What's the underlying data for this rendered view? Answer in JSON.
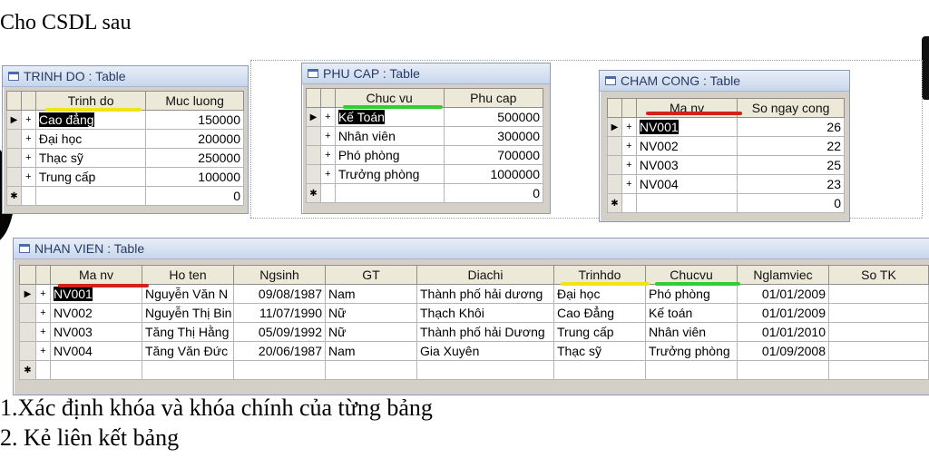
{
  "heading": "Cho CSDL sau",
  "questions": [
    "1.Xác định khóa và khóa chính của từng bảng",
    "2. Kẻ liên kết bảng"
  ],
  "colors": {
    "yellow_mark": "#f2e21b",
    "green_mark": "#2fcf2f",
    "red_mark": "#d61f1f",
    "title_text": "#263a66"
  },
  "icons": {
    "table": "table-icon",
    "current_row": "record-selector-arrow",
    "expand": "plus-sign",
    "new_row": "new-record-star"
  },
  "trinhdo": {
    "title": "TRINH DO : Table",
    "headers": [
      "Trinh do",
      "Muc luong"
    ],
    "rows": [
      [
        "Cao đẳng",
        "150000"
      ],
      [
        "Đại học",
        "200000"
      ],
      [
        "Thạc sỹ",
        "250000"
      ],
      [
        "Trung cấp",
        "100000"
      ]
    ],
    "new_row_value": "0"
  },
  "phucap": {
    "title": "PHU CAP : Table",
    "headers": [
      "Chuc vu",
      "Phu cap"
    ],
    "rows": [
      [
        "Kế Toán",
        "500000"
      ],
      [
        "Nhân viên",
        "300000"
      ],
      [
        "Phó phòng",
        "700000"
      ],
      [
        "Trưởng phòng",
        "1000000"
      ]
    ],
    "new_row_value": "0"
  },
  "chamcong": {
    "title": "CHAM CONG : Table",
    "headers": [
      "Ma nv",
      "So ngay cong"
    ],
    "rows": [
      [
        "NV001",
        "26"
      ],
      [
        "NV002",
        "22"
      ],
      [
        "NV003",
        "25"
      ],
      [
        "NV004",
        "23"
      ]
    ],
    "new_row_value": "0"
  },
  "nhanvien": {
    "title": "NHAN VIEN : Table",
    "headers": [
      "Ma nv",
      "Ho ten",
      "Ngsinh",
      "GT",
      "Diachi",
      "Trinhdo",
      "Chucvu",
      "Nglamviec",
      "So TK"
    ],
    "rows": [
      [
        "NV001",
        "Nguyễn  Văn N",
        "09/08/1987",
        "Nam",
        "Thành phố hải dương",
        "Đại học",
        "Phó phòng",
        "01/01/2009",
        ""
      ],
      [
        "NV002",
        "Nguyễn Thị Bin",
        "11/07/1990",
        "Nữ",
        "Thạch Khôi",
        "Cao Đẳng",
        "Kế toán",
        "01/01/2009",
        ""
      ],
      [
        "NV003",
        "Tăng Thị Hằng",
        "05/09/1992",
        "Nữ",
        "Thành phố hải Dương",
        "Trung cấp",
        "Nhân viên",
        "01/01/2010",
        ""
      ],
      [
        "NV004",
        "Tăng Văn Đức",
        "20/06/1987",
        "Nam",
        "Gia Xuyên",
        "Thạc sỹ",
        "Trưởng phòng",
        "01/09/2008",
        ""
      ]
    ]
  }
}
